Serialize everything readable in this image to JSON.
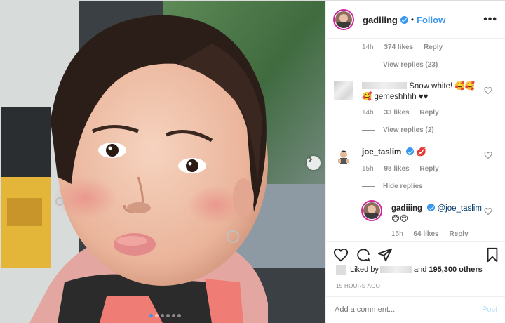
{
  "header": {
    "username": "gadiiing",
    "separator": "•",
    "follow_label": "Follow",
    "more_label": "•••"
  },
  "photo": {
    "carousel_dot_count": 6,
    "active_dot": 0
  },
  "comments": {
    "first_meta": {
      "time": "14h",
      "likes": "374 likes",
      "reply": "Reply"
    },
    "view_replies_1": "View replies (23)",
    "comment_2": {
      "text_line1": "Snow white! 🥰🥰",
      "text_line2": "🥰 gemeshhhh ♥♥",
      "time": "14h",
      "likes": "33 likes",
      "reply": "Reply"
    },
    "view_replies_2": "View replies (2)",
    "comment_3": {
      "username": "joe_taslim",
      "emoji": "💋",
      "time": "15h",
      "likes": "98 likes",
      "reply": "Reply"
    },
    "hide_replies": "Hide replies",
    "reply_1": {
      "username": "gadiiing",
      "mention": "@joe_taslim",
      "emoji_line": "😊😊",
      "time": "15h",
      "likes": "64 likes",
      "reply": "Reply"
    }
  },
  "engagement": {
    "liked_by_label": "Liked by",
    "and_label": "and",
    "others_count": "195,300 others",
    "time_ago": "15 HOURS AGO"
  },
  "add_comment": {
    "placeholder": "Add a comment...",
    "post_label": "Post"
  },
  "colors": {
    "accent_blue": "#3897f0",
    "text": "#262626",
    "muted": "#8e8e8e",
    "like_red": "#ed4956"
  }
}
